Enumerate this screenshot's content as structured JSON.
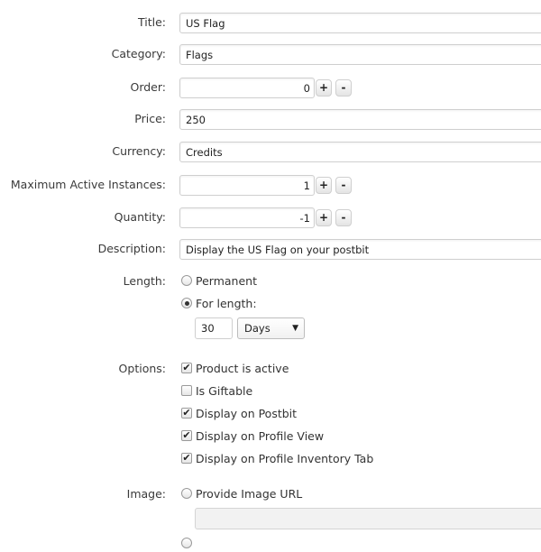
{
  "form": {
    "title": {
      "label": "Title:",
      "value": "US Flag"
    },
    "category": {
      "label": "Category:",
      "value": "Flags"
    },
    "order": {
      "label": "Order:",
      "value": "0",
      "plus": "+",
      "minus": "-"
    },
    "price": {
      "label": "Price:",
      "value": "250"
    },
    "currency": {
      "label": "Currency:",
      "value": "Credits"
    },
    "max_instances": {
      "label": "Maximum Active Instances:",
      "value": "1",
      "plus": "+",
      "minus": "-"
    },
    "quantity": {
      "label": "Quantity:",
      "value": "-1",
      "plus": "+",
      "minus": "-"
    },
    "description": {
      "label": "Description:",
      "value": "Display the US Flag on your postbit"
    },
    "length": {
      "label": "Length:",
      "permanent_label": "Permanent",
      "for_length_label": "For length:",
      "selected": "for_length",
      "amount": "30",
      "unit": "Days"
    },
    "options": {
      "label": "Options:",
      "items": [
        {
          "label": "Product is active",
          "checked": true
        },
        {
          "label": "Is Giftable",
          "checked": false
        },
        {
          "label": "Display on Postbit",
          "checked": true
        },
        {
          "label": "Display on Profile View",
          "checked": true
        },
        {
          "label": "Display on Profile Inventory Tab",
          "checked": true
        }
      ]
    },
    "image": {
      "label": "Image:",
      "provide_url_label": "Provide Image URL",
      "url_value": ""
    }
  },
  "icons": {
    "check": "✔",
    "caret": "▼"
  }
}
